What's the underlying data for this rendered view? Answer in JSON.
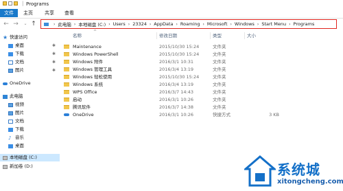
{
  "window": {
    "title": "Programs"
  },
  "ribbon": {
    "tabs": [
      "文件",
      "主页",
      "共享",
      "查看"
    ]
  },
  "address": {
    "crumbs": [
      "此电脑",
      "本地磁盘 (C:)",
      "Users",
      "23324",
      "AppData",
      "Roaming",
      "Microsoft",
      "Windows",
      "Start Menu",
      "Programs"
    ]
  },
  "sidebar": {
    "items": [
      {
        "label": "快速访问",
        "icon": "star-icon"
      },
      {
        "label": "桌面",
        "icon": "desktop-icon",
        "pinned": true
      },
      {
        "label": "下载",
        "icon": "download-icon",
        "pinned": true
      },
      {
        "label": "文档",
        "icon": "document-icon",
        "pinned": true
      },
      {
        "label": "图片",
        "icon": "picture-icon",
        "pinned": true
      },
      {
        "label": "OneDrive",
        "icon": "cloud-icon"
      },
      {
        "label": "此电脑",
        "icon": "computer-icon"
      },
      {
        "label": "视频",
        "icon": "video-icon"
      },
      {
        "label": "图片",
        "icon": "picture-icon"
      },
      {
        "label": "文档",
        "icon": "document-icon"
      },
      {
        "label": "下载",
        "icon": "download-icon"
      },
      {
        "label": "音乐",
        "icon": "music-icon"
      },
      {
        "label": "桌面",
        "icon": "desktop-icon"
      },
      {
        "label": "本地磁盘 (C:)",
        "icon": "drive-icon",
        "selected": true
      },
      {
        "label": "新加卷 (D:)",
        "icon": "drive-icon"
      }
    ]
  },
  "columns": {
    "name": "名称",
    "date": "修改日期",
    "type": "类型",
    "size": "大小"
  },
  "files": [
    {
      "name": "Maintenance",
      "date": "2015/10/30 15:24",
      "type": "文件夹",
      "size": ""
    },
    {
      "name": "Windows PowerShell",
      "date": "2015/10/30 15:24",
      "type": "文件夹",
      "size": ""
    },
    {
      "name": "Windows 附件",
      "date": "2016/3/1 10:31",
      "type": "文件夹",
      "size": ""
    },
    {
      "name": "Windows 管理工具",
      "date": "2016/3/4 13:19",
      "type": "文件夹",
      "size": ""
    },
    {
      "name": "Windows 轻松使用",
      "date": "2015/10/30 15:24",
      "type": "文件夹",
      "size": ""
    },
    {
      "name": "Windows 系统",
      "date": "2016/3/4 13:19",
      "type": "文件夹",
      "size": ""
    },
    {
      "name": "WPS Office",
      "date": "2016/3/7 14:43",
      "type": "文件夹",
      "size": ""
    },
    {
      "name": "启动",
      "date": "2016/3/1 10:26",
      "type": "文件夹",
      "size": ""
    },
    {
      "name": "腾讯软件",
      "date": "2016/3/7 14:38",
      "type": "文件夹",
      "size": ""
    },
    {
      "name": "OneDrive",
      "date": "2016/3/1 10:26",
      "type": "快捷方式",
      "size": "3 KB"
    }
  ],
  "watermark": {
    "brand": "系统城",
    "url": "xitongcheng.com"
  }
}
